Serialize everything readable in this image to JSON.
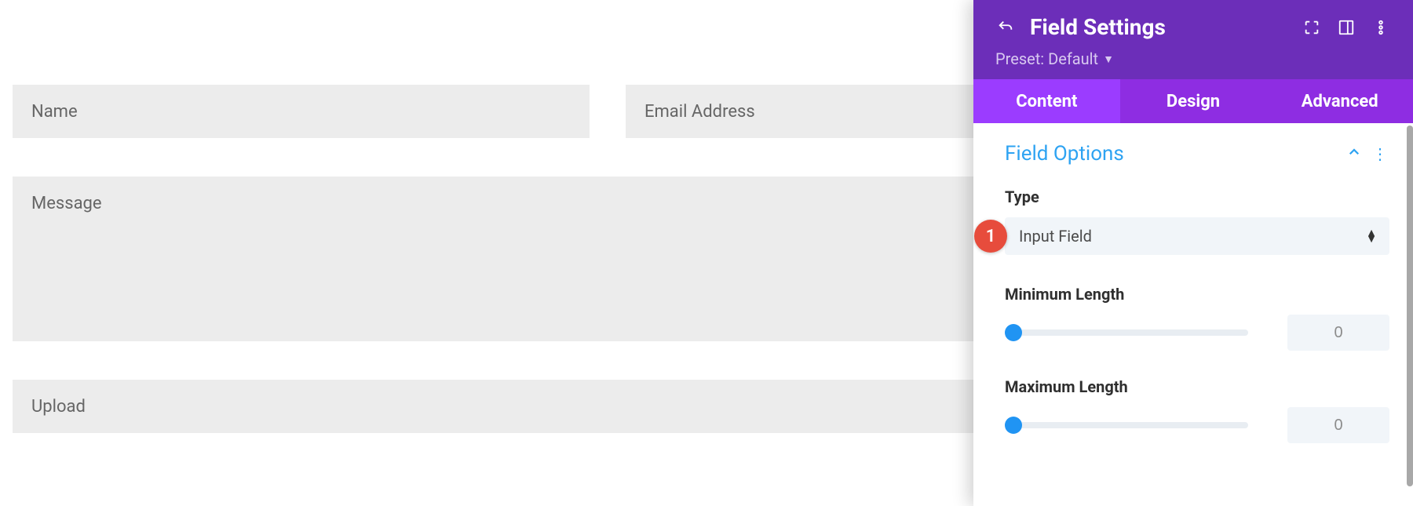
{
  "form": {
    "name_placeholder": "Name",
    "email_placeholder": "Email Address",
    "message_placeholder": "Message",
    "upload_placeholder": "Upload"
  },
  "panel": {
    "title": "Field Settings",
    "preset_label": "Preset: Default",
    "tabs": {
      "content": "Content",
      "design": "Design",
      "advanced": "Advanced"
    },
    "active_tab": "content",
    "section_title": "Field Options",
    "type_label": "Type",
    "type_value": "Input Field",
    "min_label": "Minimum Length",
    "min_value": "0",
    "max_label": "Maximum Length",
    "max_value": "0",
    "callout": "1"
  }
}
